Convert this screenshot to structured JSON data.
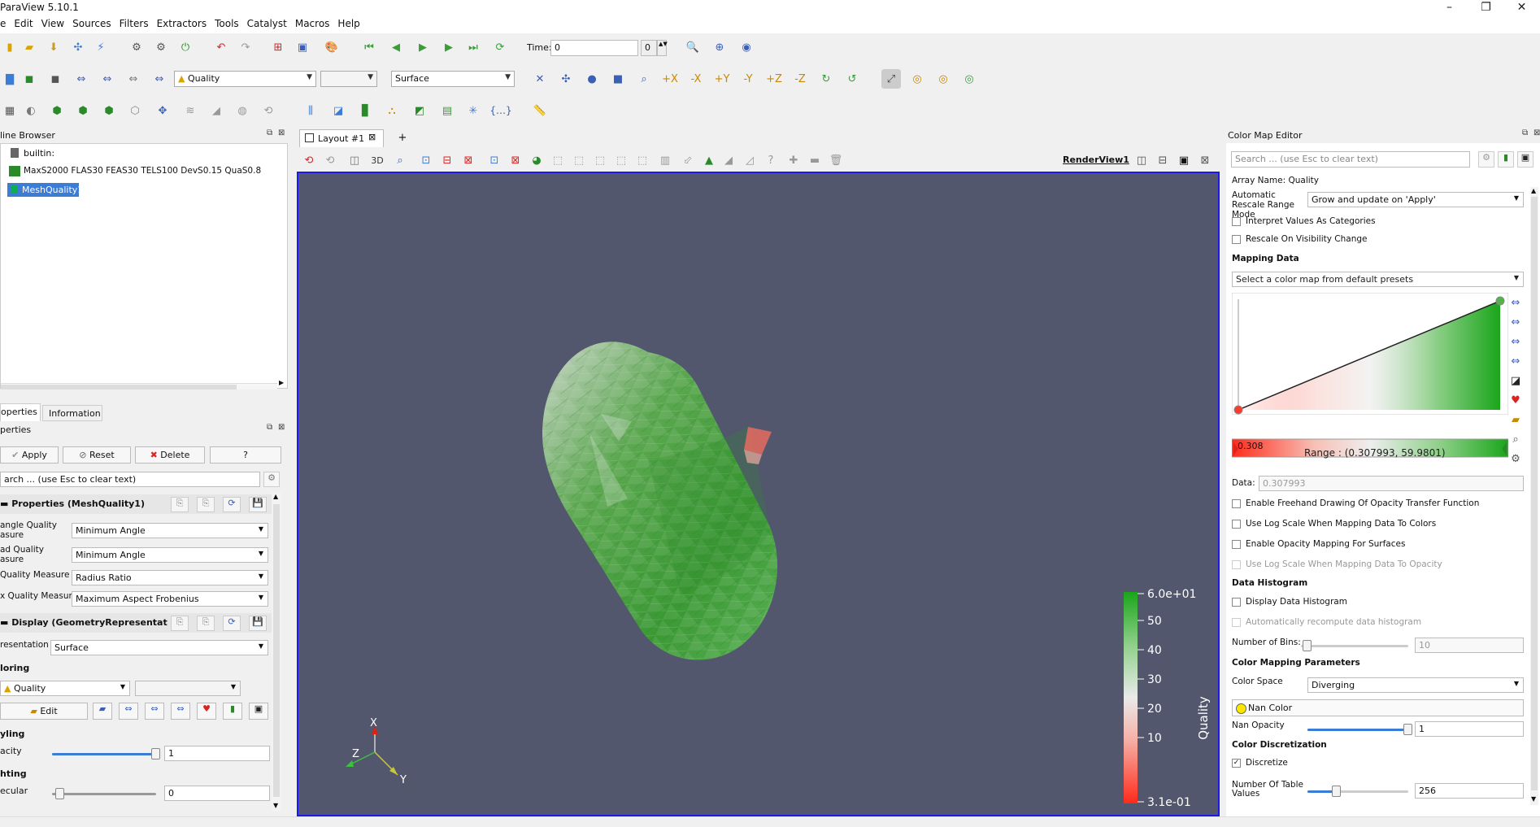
{
  "window": {
    "title": "ParaView 5.10.1",
    "minimize": "–",
    "restore": "❐",
    "close": "✕"
  },
  "menu": [
    "e",
    "Edit",
    "View",
    "Sources",
    "Filters",
    "Extractors",
    "Tools",
    "Catalyst",
    "Macros",
    "Help"
  ],
  "toolbar": {
    "time_label": "Time:",
    "time_value": "0",
    "time_index": "0",
    "color_by": "Quality",
    "color_component": "",
    "representation": "Surface"
  },
  "pipeline": {
    "title": "line Browser",
    "items": [
      "builtin:",
      "MaxS2000 FLAS30 FEAS30 TELS100 DevS0.15 QuaS0.8",
      "MeshQuality1"
    ]
  },
  "properties": {
    "tabs": [
      "operties",
      "Information"
    ],
    "title": "perties",
    "apply": "Apply",
    "reset": "Reset",
    "delete": "Delete",
    "help": "?",
    "search_placeholder": "arch ... (use Esc to clear text)",
    "section1": "Properties (MeshQuality1)",
    "rows": [
      {
        "label1": "angle Quality",
        "label2": "asure",
        "value": "Minimum Angle"
      },
      {
        "label1": "ad Quality",
        "label2": "asure",
        "value": "Minimum Angle"
      },
      {
        "label1": "Quality Measure",
        "label2": "",
        "value": "Radius Ratio"
      },
      {
        "label1": "x Quality Measure",
        "label2": "",
        "value": "Maximum Aspect Frobenius"
      }
    ],
    "section2": "Display (GeometryRepresentat",
    "representation_label": "resentation",
    "representation_value": "Surface",
    "coloring_label": "loring",
    "coloring_value": "Quality",
    "edit": "Edit",
    "styling_label": "yling",
    "opacity_label": "acity",
    "opacity_value": "1",
    "lighting_label": "hting",
    "specular_label": "ecular",
    "specular_value": "0",
    "opacity_fraction": 1.0,
    "specular_fraction": 0.0
  },
  "layout": {
    "tab": "Layout #1",
    "add": "+",
    "view_name": "RenderView1",
    "button_3d": "3D"
  },
  "colorbar": {
    "title": "Quality",
    "ticks": [
      "6.0e+01",
      "50",
      "40",
      "30",
      "20",
      "10",
      "3.1e-01"
    ]
  },
  "axes": {
    "x": "X",
    "y": "Y",
    "z": "Z"
  },
  "cme": {
    "title": "Color Map Editor",
    "search_placeholder": "Search ... (use Esc to clear text)",
    "array_name": "Array Name: Quality",
    "rescale_label": "Automatic Rescale Range Mode",
    "rescale_value": "Grow and update on 'Apply'",
    "interpret": "Interpret Values As Categories",
    "rescale_vis": "Rescale On Visibility Change",
    "mapping_data": "Mapping Data",
    "preset_placeholder": "Select a color map from default presets",
    "range_min": "0.308",
    "range_text": "Range : (0.307993, 59.9801)",
    "data_label": "Data:",
    "data_value": "0.307993",
    "opts": [
      "Enable Freehand Drawing Of Opacity Transfer Function",
      "Use Log Scale When Mapping Data To Colors",
      "Enable Opacity Mapping For Surfaces",
      "Use Log Scale When Mapping Data To Opacity"
    ],
    "histogram": "Data Histogram",
    "display_hist": "Display Data Histogram",
    "auto_hist": "Automatically recompute data histogram",
    "bins_label": "Number of Bins:",
    "bins_value": "10",
    "params": "Color Mapping Parameters",
    "space_label": "Color Space",
    "space_value": "Diverging",
    "nan_color": "Nan Color",
    "nan_opacity_label": "Nan Opacity",
    "nan_opacity_value": "1",
    "discretization": "Color Discretization",
    "discretize": "Discretize",
    "table_label": "Number Of Table Values",
    "table_value": "256"
  },
  "colors": {
    "accent": "#3b7cd6",
    "view_bg": "#52576e",
    "green": "#1aa51a",
    "red": "#ff2a1a"
  }
}
